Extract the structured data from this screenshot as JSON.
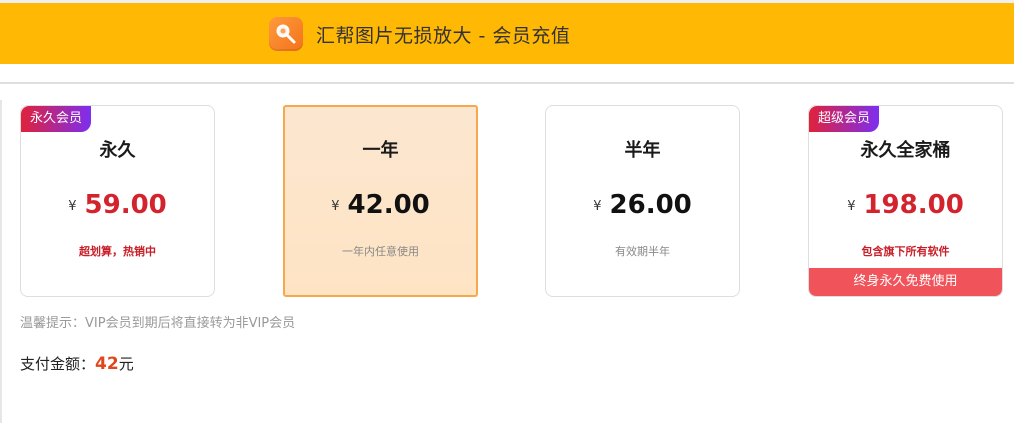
{
  "header": {
    "title": "汇帮图片无损放大 - 会员充值",
    "logo_icon": "magnifier-logo-icon",
    "background_color": "#ffb804"
  },
  "plans": [
    {
      "badge": "永久会员",
      "name": "永久",
      "currency": "¥",
      "price": "59.00",
      "price_color": "#d3232d",
      "desc": "超划算，热销中",
      "bottom_bar": "",
      "selected": false
    },
    {
      "badge": "",
      "name": "一年",
      "currency": "¥",
      "price": "42.00",
      "price_color": "#111111",
      "desc": "一年内任意使用",
      "bottom_bar": "",
      "selected": true
    },
    {
      "badge": "",
      "name": "半年",
      "currency": "¥",
      "price": "26.00",
      "price_color": "#111111",
      "desc": "有效期半年",
      "bottom_bar": "",
      "selected": false
    },
    {
      "badge": "超级会员",
      "name": "永久全家桶",
      "currency": "¥",
      "price": "198.00",
      "price_color": "#d3232d",
      "desc": "包含旗下所有软件",
      "bottom_bar": "终身永久免费使用",
      "selected": false
    }
  ],
  "tip": "温馨提示：VIP会员到期后将直接转为非VIP会员",
  "payment": {
    "label": "支付金额：",
    "amount": "42",
    "unit": "元"
  }
}
